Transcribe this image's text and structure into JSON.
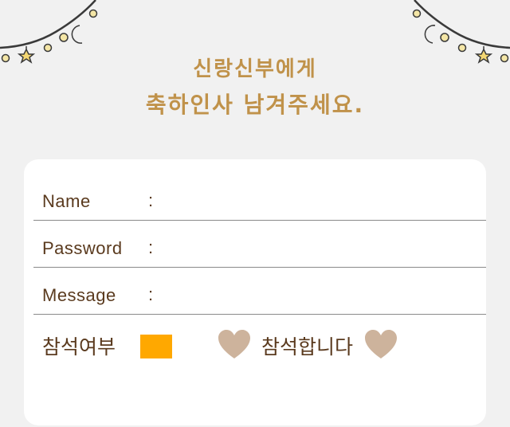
{
  "header": {
    "line1": "신랑신부에게",
    "line2": "축하인사 남겨주세요."
  },
  "form": {
    "name_label": "Name",
    "password_label": "Password",
    "message_label": "Message",
    "colon": ":",
    "name_value": "",
    "password_value": "",
    "message_value": "",
    "attend_label": "참석여부",
    "attend_option": "참석합니다"
  },
  "colors": {
    "background": "#f1f1f1",
    "heading": "#c0924a",
    "text": "#5a3a1e",
    "checkbox": "#ffa800",
    "heart": "#cdb39c"
  }
}
